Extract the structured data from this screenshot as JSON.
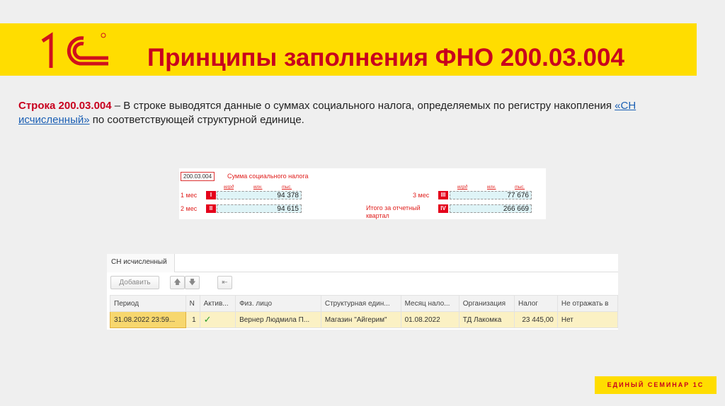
{
  "header": {
    "title": "Принципы заполнения ФНО 200.03.004",
    "logo_text": "1С"
  },
  "description": {
    "bold": "Строка 200.03.004",
    "text1": " – В строке выводятся данные о суммах социального налога, определяемых по регистру накопления ",
    "link": "«СН исчисленный»",
    "text2": " по соответствующей структурной единице."
  },
  "form": {
    "code": "200.03.004",
    "heading": "Сумма социального налога",
    "col_headers": [
      "млрд",
      "млн.",
      "тыс."
    ],
    "rows": [
      {
        "label": "1 мес",
        "num": "I",
        "value": "94 378"
      },
      {
        "label": "2 мес",
        "num": "II",
        "value": "94 615"
      },
      {
        "label": "3 мес",
        "num": "III",
        "value": "77 676"
      },
      {
        "label": "Итого за отчетный квартал",
        "num": "IV",
        "value": "266 669"
      }
    ]
  },
  "register": {
    "tab": "СН исчисленный",
    "add_button": "Добавить",
    "up": "🡅",
    "down": "🡇",
    "columns": [
      "Период",
      "N",
      "Актив...",
      "Физ. лицо",
      "Структурная един...",
      "Месяц нало...",
      "Организация",
      "Налог",
      "Не отражать в"
    ],
    "rows": [
      [
        "31.08.2022 23:59...",
        "1",
        "✓",
        "Вернер Людмила П...",
        "Магазин \"Айгерим\"",
        "01.08.2022",
        "ТД Лакомка",
        "23 445,00",
        "Нет"
      ]
    ]
  },
  "footer": {
    "text": "ЕДИНЫЙ СЕМИНАР 1С"
  },
  "colors": {
    "accent": "#c8001e",
    "band": "#ffdd00"
  }
}
